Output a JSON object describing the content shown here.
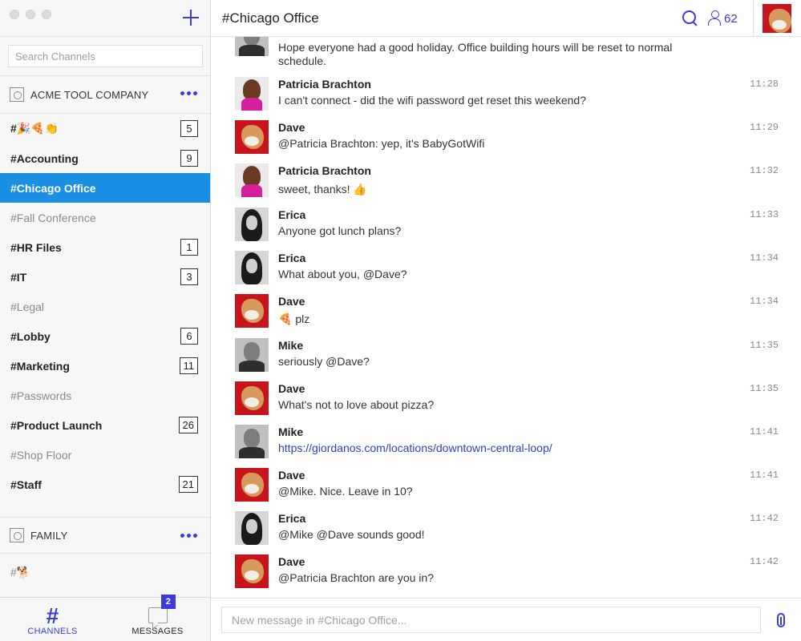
{
  "sidebar": {
    "search_placeholder": "Search Channels",
    "team": {
      "name": "ACME TOOL COMPANY"
    },
    "channels": [
      {
        "label": "#🎉🍕👏",
        "badge": "5",
        "state": "unread"
      },
      {
        "label": "#Accounting",
        "badge": "9",
        "state": "unread"
      },
      {
        "label": "#Chicago Office",
        "badge": "",
        "state": "active"
      },
      {
        "label": "#Fall Conference",
        "badge": "",
        "state": "read"
      },
      {
        "label": "#HR Files",
        "badge": "1",
        "state": "unread"
      },
      {
        "label": "#IT",
        "badge": "3",
        "state": "unread"
      },
      {
        "label": "#Legal",
        "badge": "",
        "state": "read"
      },
      {
        "label": "#Lobby",
        "badge": "6",
        "state": "unread"
      },
      {
        "label": "#Marketing",
        "badge": "11",
        "state": "unread"
      },
      {
        "label": "#Passwords",
        "badge": "",
        "state": "read"
      },
      {
        "label": "#Product Launch",
        "badge": "26",
        "state": "unread"
      },
      {
        "label": "#Shop Floor",
        "badge": "",
        "state": "read"
      },
      {
        "label": "#Staff",
        "badge": "21",
        "state": "unread"
      }
    ],
    "family": {
      "name": "FAMILY",
      "channel": "#🐕"
    },
    "nav": {
      "channels_label": "CHANNELS",
      "messages_label": "MESSAGES",
      "messages_badge": "2"
    }
  },
  "header": {
    "title": "#Chicago Office",
    "member_count": "62"
  },
  "messages": [
    {
      "name": "",
      "text": "Hope everyone had a good holiday. Office building hours will be reset to normal schedule.",
      "time": "",
      "avatar": "mike"
    },
    {
      "name": "Patricia Brachton",
      "text": "I can't connect - did the wifi password get reset this weekend?",
      "time": "11:28",
      "avatar": "patricia"
    },
    {
      "name": "Dave",
      "text": "@Patricia Brachton: yep, it's BabyGotWifi",
      "time": "11:29",
      "avatar": "dave"
    },
    {
      "name": "Patricia Brachton",
      "text": "sweet, thanks! 👍",
      "time": "11:32",
      "avatar": "patricia"
    },
    {
      "name": "Erica",
      "text": "Anyone got lunch plans?",
      "time": "11:33",
      "avatar": "erica"
    },
    {
      "name": "Erica",
      "text": "What about you, @Dave?",
      "time": "11:34",
      "avatar": "erica"
    },
    {
      "name": "Dave",
      "text": "🍕 plz",
      "time": "11:34",
      "avatar": "dave"
    },
    {
      "name": "Mike",
      "text": "seriously @Dave?",
      "time": "11:35",
      "avatar": "mike"
    },
    {
      "name": "Dave",
      "text": "What's not to love about pizza?",
      "time": "11:35",
      "avatar": "dave"
    },
    {
      "name": "Mike",
      "text": "https://giordanos.com/locations/downtown-central-loop/",
      "time": "11:41",
      "avatar": "mike",
      "is_link": true
    },
    {
      "name": "Dave",
      "text": "@Mike. Nice. Leave in 10?",
      "time": "11:41",
      "avatar": "dave"
    },
    {
      "name": "Erica",
      "text": "@Mike @Dave sounds good!",
      "time": "11:42",
      "avatar": "erica"
    },
    {
      "name": "Dave",
      "text": "@Patricia Brachton are you in?",
      "time": "11:42",
      "avatar": "dave"
    }
  ],
  "composer": {
    "placeholder": "New message in #Chicago Office..."
  },
  "colors": {
    "accent": "#3d3ad8",
    "active_channel": "#1a8fe3"
  }
}
